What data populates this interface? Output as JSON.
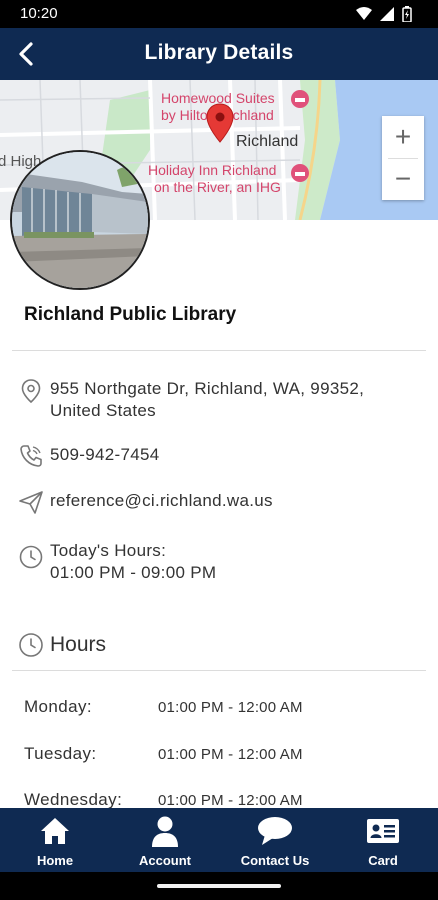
{
  "status_bar": {
    "time": "10:20"
  },
  "app_bar": {
    "title": "Library Details"
  },
  "map": {
    "labels": {
      "hotel1_line1": "Homewood Suites",
      "hotel1_line2": "by Hilton Richland",
      "city": "Richland",
      "hotel2_line1": "Holiday Inn Richland",
      "hotel2_line2": "on the River, an IHG",
      "road": "d High"
    },
    "zoom_in": "+",
    "zoom_out": "−"
  },
  "library": {
    "name": "Richland Public Library",
    "address_line1": "955 Northgate Dr, Richland, WA, 99352,",
    "address_line2": "United States",
    "phone": "509-942-7454",
    "email": "reference@ci.richland.wa.us",
    "todays_hours_label": "Today's Hours:",
    "todays_hours_value": "01:00 PM - 09:00 PM"
  },
  "hours": {
    "heading": "Hours",
    "days": [
      {
        "day": "Monday:",
        "time": "01:00 PM - 12:00 AM"
      },
      {
        "day": "Tuesday:",
        "time": "01:00 PM - 12:00 AM"
      },
      {
        "day": "Wednesday:",
        "time": "01:00 PM - 12:00 AM"
      }
    ]
  },
  "bottom_nav": [
    {
      "label": "Home",
      "icon": "home-icon"
    },
    {
      "label": "Account",
      "icon": "account-icon"
    },
    {
      "label": "Contact Us",
      "icon": "chat-icon"
    },
    {
      "label": "Card",
      "icon": "card-icon"
    }
  ],
  "colors": {
    "primary": "#0f2a52",
    "map_pin": "#e53935",
    "map_water": "#a8c8f2",
    "map_park": "#c5e8c5",
    "poi_text": "#d4456b"
  }
}
